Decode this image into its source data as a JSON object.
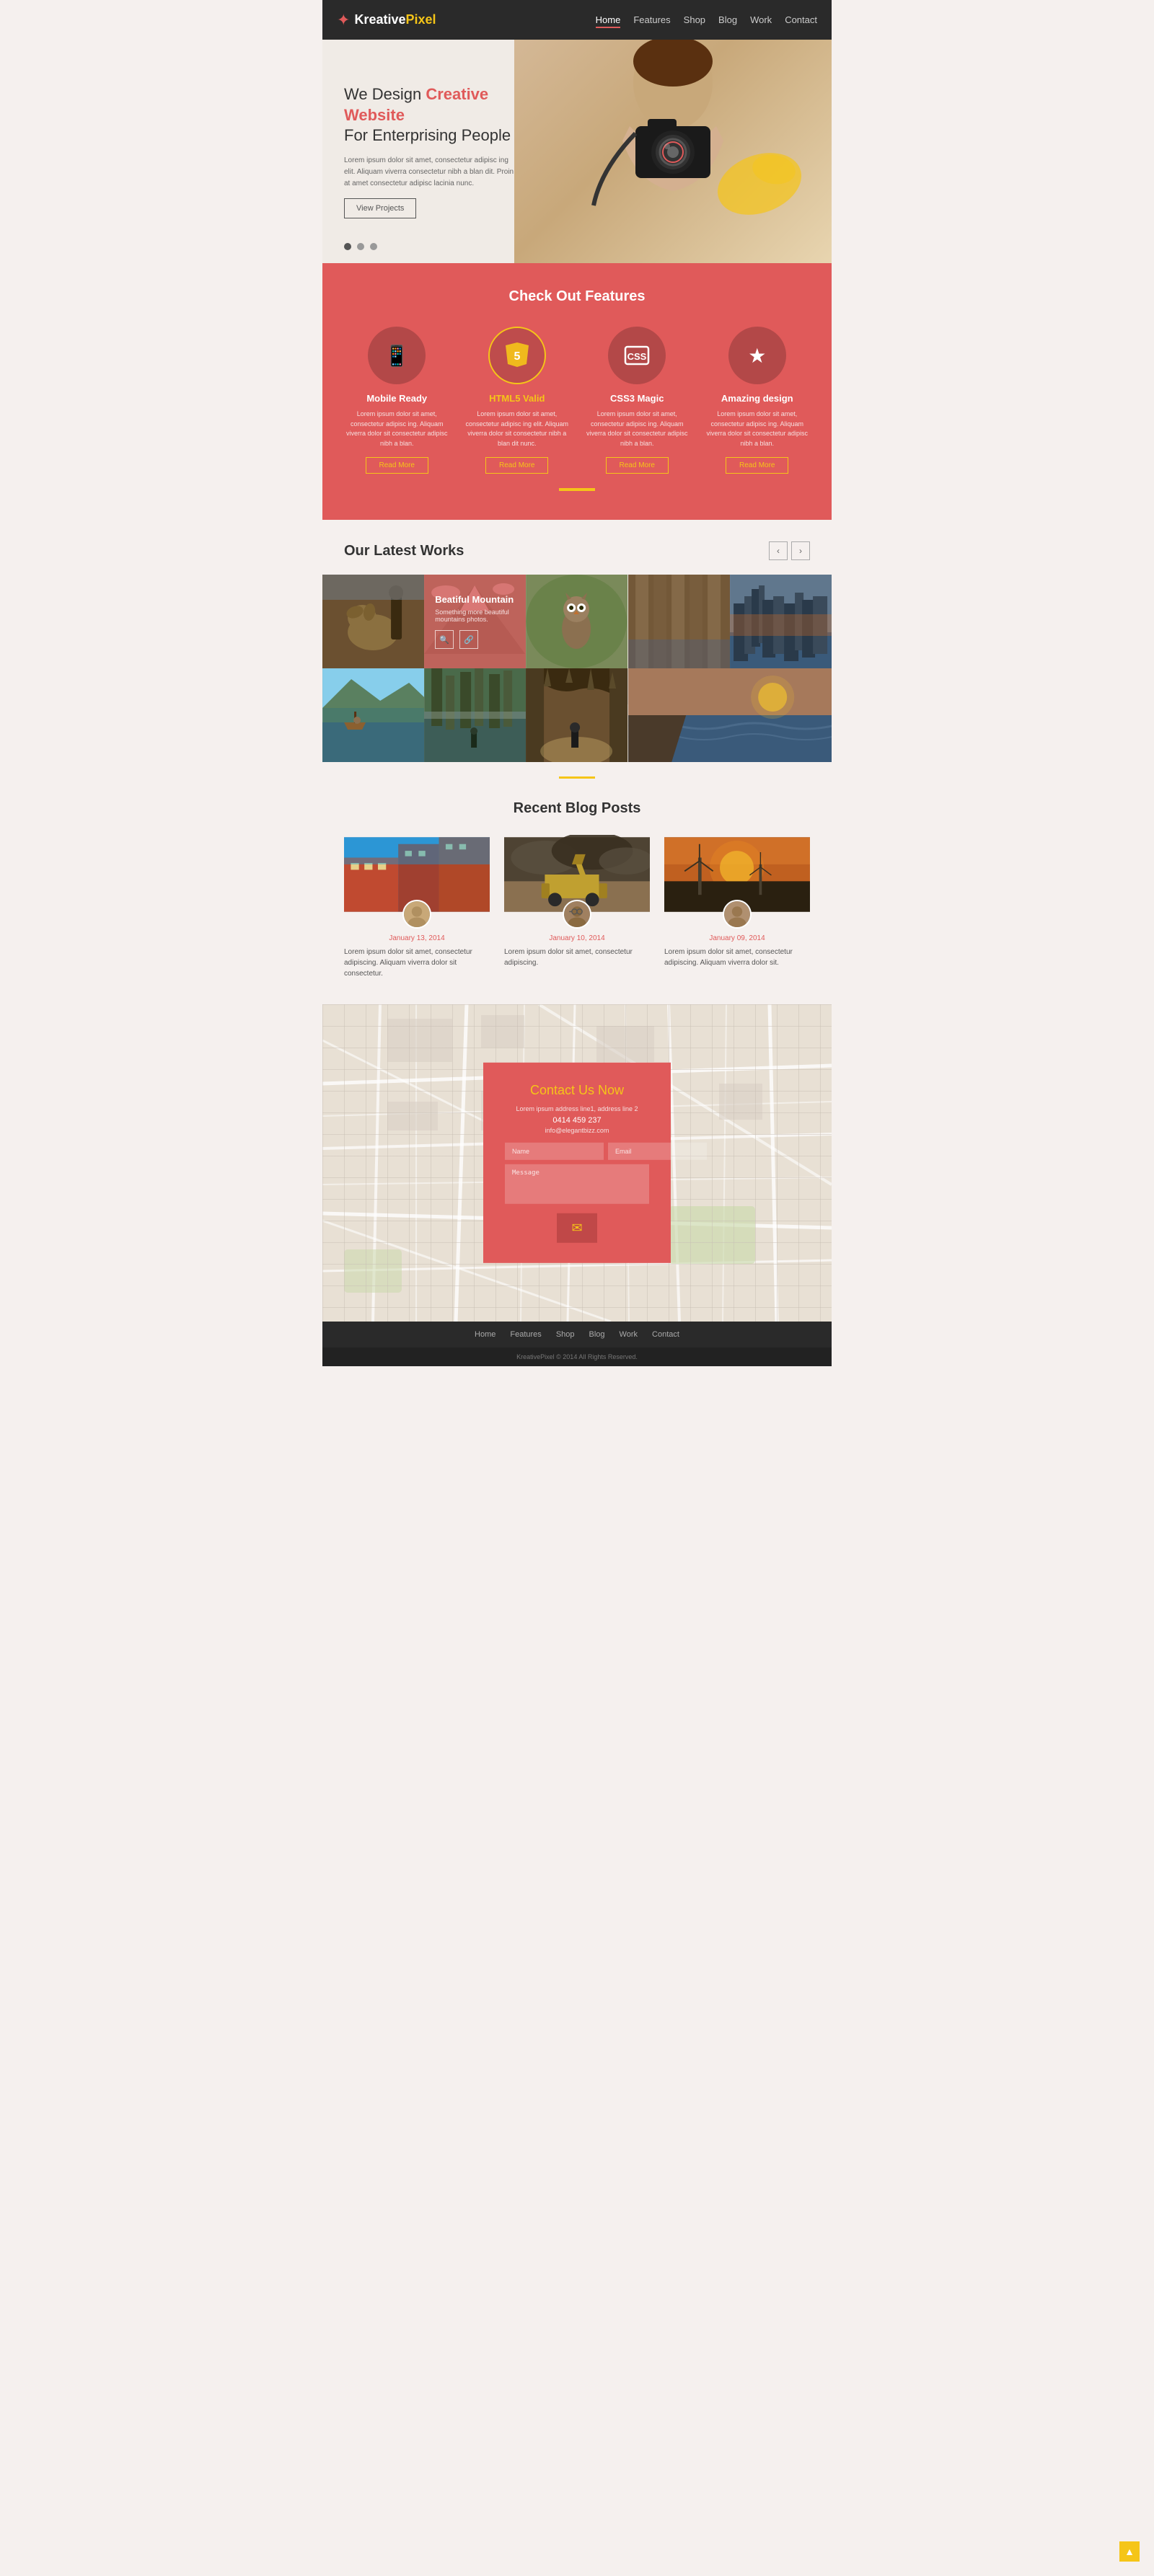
{
  "navbar": {
    "logo_kreative": "Kreative",
    "logo_pixel": "Pixel",
    "nav_items": [
      {
        "label": "Home",
        "active": true
      },
      {
        "label": "Features",
        "active": false
      },
      {
        "label": "Shop",
        "active": false
      },
      {
        "label": "Blog",
        "active": false
      },
      {
        "label": "Work",
        "active": false
      },
      {
        "label": "Contact",
        "active": false
      }
    ]
  },
  "hero": {
    "title_line1": "We Design",
    "title_highlight": "Creative Website",
    "title_line2": "For Enterprising People",
    "description": "Lorem ipsum dolor sit amet, consectetur adipisc ing elit. Aliquam viverra consectetur nibh a blan dit. Proin at amet consectetur adipisc lacinia nunc.",
    "btn_label": "View Projects"
  },
  "features": {
    "section_title_normal": "Check Out",
    "section_title_bold": "Features",
    "items": [
      {
        "icon": "📱",
        "title": "Mobile Ready",
        "title_color": "white",
        "description": "Lorem ipsum dolor sit amet, consectetur adipisc ing. Aliquam viverra  dolor sit consectetur adipisc nibh a blan.",
        "btn_label": "Read More"
      },
      {
        "icon": "5",
        "title": "HTML5 Valid",
        "title_color": "yellow",
        "description": "Lorem ipsum dolor sit amet, consectetur adipisc ing elit. Aliquam viverra  dolor sit consectetur nibh a blan dit nunc.",
        "btn_label": "Read More"
      },
      {
        "icon": "CSS",
        "title": "CSS3 Magic",
        "title_color": "white",
        "description": "Lorem ipsum dolor sit amet, consectetur adipisc ing. Aliquam viverra  dolor sit consectetur adipisc nibh a blan.",
        "btn_label": "Read More"
      },
      {
        "icon": "★",
        "title": "Amazing design",
        "title_color": "white",
        "description": "Lorem ipsum dolor sit amet, consectetur adipisc ing. Aliquam viverra  dolor sit consectetur adipisc nibh a blan.",
        "btn_label": "Read More"
      }
    ]
  },
  "works": {
    "title_normal": "Our Latest",
    "title_bold": "Works",
    "overlay_item": {
      "title": "Beatiful Mountain",
      "description": "Something more beautiful mountains photos."
    },
    "photos": [
      {
        "label": "dog-photo",
        "color": "#6B5030"
      },
      {
        "label": "mountain-overlay",
        "color": "#c05050"
      },
      {
        "label": "owl-photo",
        "color": "#6B7A50"
      },
      {
        "label": "wood-photo",
        "color": "#7B6040"
      },
      {
        "label": "city-photo",
        "color": "#3a5a7a"
      },
      {
        "label": "lake-photo",
        "color": "#4a7a6a"
      },
      {
        "label": "forest-photo",
        "color": "#4a6a3a"
      },
      {
        "label": "cave-photo",
        "color": "#8a7050"
      },
      {
        "label": "coast-photo",
        "color": "#507090"
      }
    ]
  },
  "blog": {
    "title_normal": "Recent",
    "title_bold": "Blog Posts",
    "posts": [
      {
        "date": "January 13, 2014",
        "text": "Lorem ipsum dolor sit amet, consectetur adipiscing. Aliquam viverra  dolor sit consectetur."
      },
      {
        "date": "January 10, 2014",
        "text": "Lorem ipsum dolor sit amet, consectetur adipiscing."
      },
      {
        "date": "January 09, 2014",
        "text": "Lorem ipsum dolor sit amet, consectetur adipiscing. Aliquam viverra  dolor sit."
      }
    ]
  },
  "contact": {
    "title": "Contact Us Now",
    "address": "Lorem ipsum address line1, address line 2",
    "phone": "0414 459 237",
    "email": "info@elegantbizz.com",
    "name_placeholder": "Name",
    "email_placeholder": "Email",
    "message_placeholder": "Message"
  },
  "footer": {
    "nav_items": [
      "Home",
      "Features",
      "Shop",
      "Blog",
      "Work",
      "Contact"
    ],
    "copyright": "KreativePixel © 2014 All Rights Reserved."
  }
}
